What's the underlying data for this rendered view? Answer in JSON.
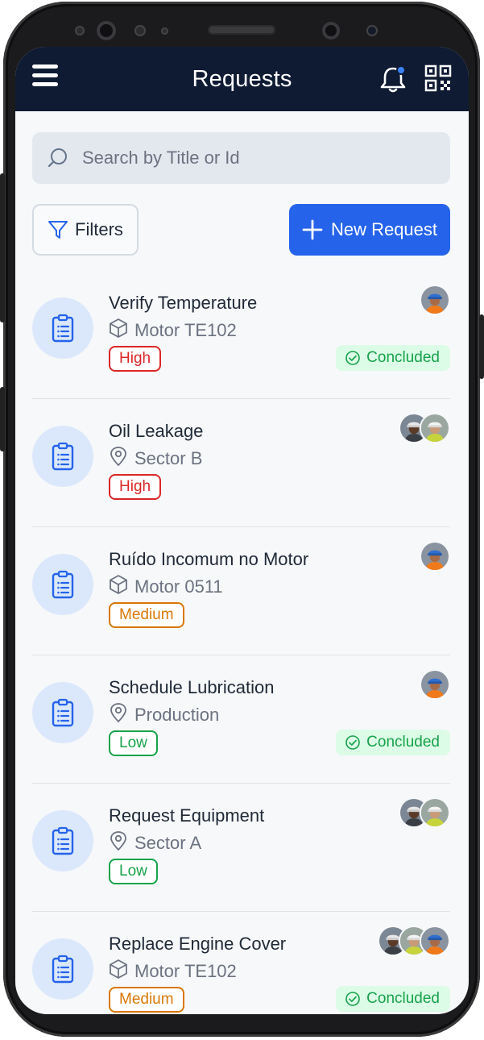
{
  "app": {
    "title": "Requests"
  },
  "search": {
    "placeholder": "Search by Title or Id"
  },
  "toolbar": {
    "filters_label": "Filters",
    "new_request_label": "New Request"
  },
  "colors": {
    "appbar": "#0f1b33",
    "primary": "#2563eb",
    "high": "#dc2626",
    "medium": "#d97706",
    "low": "#16a34a"
  },
  "requests": [
    {
      "title": "Verify Temperature",
      "location": "Motor TE102",
      "location_icon": "box-icon",
      "priority": "High",
      "status": "Concluded",
      "assignees": [
        "orange-helmet"
      ]
    },
    {
      "title": "Oil Leakage",
      "location": "Sector B",
      "location_icon": "map-pin-icon",
      "priority": "High",
      "status": "",
      "assignees": [
        "dark-helmet",
        "white-helmet"
      ]
    },
    {
      "title": "Ruído Incomum no Motor",
      "location": "Motor 0511",
      "location_icon": "box-icon",
      "priority": "Medium",
      "status": "",
      "assignees": [
        "orange-helmet"
      ]
    },
    {
      "title": "Schedule Lubrication",
      "location": "Production",
      "location_icon": "map-pin-icon",
      "priority": "Low",
      "status": "Concluded",
      "assignees": [
        "orange-helmet"
      ]
    },
    {
      "title": "Request Equipment",
      "location": "Sector A",
      "location_icon": "map-pin-icon",
      "priority": "Low",
      "status": "",
      "assignees": [
        "dark-helmet",
        "white-helmet"
      ]
    },
    {
      "title": "Replace Engine Cover",
      "location": "Motor TE102",
      "location_icon": "box-icon",
      "priority": "Medium",
      "status": "Concluded",
      "assignees": [
        "dark-helmet",
        "white-helmet",
        "orange-helmet"
      ]
    }
  ]
}
